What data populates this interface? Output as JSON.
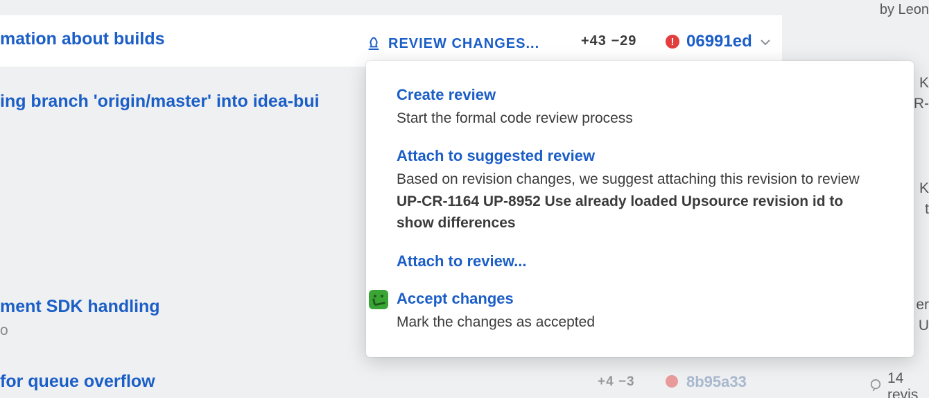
{
  "byline": "by Leon",
  "commits": {
    "c1": {
      "title": "mation about builds",
      "review_label": "REVIEW CHANGES...",
      "stats": "+43 −29",
      "hash": "06991ed"
    },
    "c2": {
      "title": "ing branch 'origin/master' into idea-bui"
    },
    "c3": {
      "title": "ment SDK handling",
      "sub": "o"
    },
    "c4": {
      "title": "  for queue overflow",
      "stats": "+4 −3",
      "hash": "8b95a33"
    }
  },
  "right_fragments": {
    "r1a": "  K",
    "r1b": "R-",
    "r2a": "  K",
    "r2b": "t",
    "r3a": "er",
    "r3b": "U"
  },
  "bottom_revis": "14 revis",
  "popover": {
    "create": {
      "title": "Create review",
      "desc": "Start the formal code review process"
    },
    "suggest": {
      "title": "Attach to suggested review",
      "desc_pre": "Based on revision changes, we suggest attaching this revision to review ",
      "bold": "UP-CR-1164 UP-8952 Use already loaded Upsource revision id to show differences"
    },
    "attach": {
      "title": "Attach to review..."
    },
    "accept": {
      "title": "Accept changes",
      "desc": "Mark the changes as accepted"
    }
  }
}
